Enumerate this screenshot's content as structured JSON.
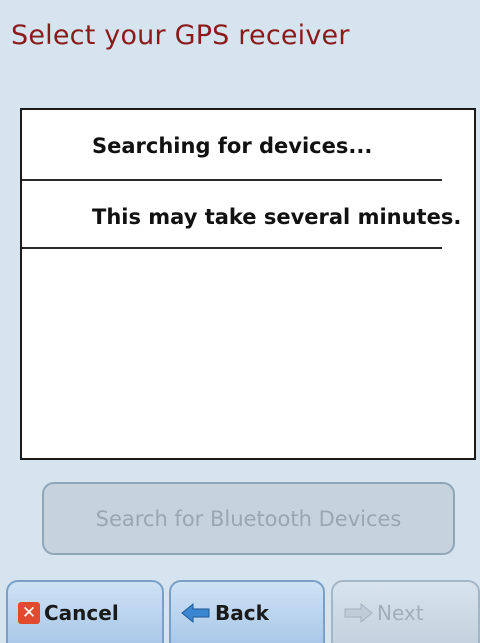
{
  "title": "Select your GPS receiver",
  "list": {
    "rows": [
      {
        "text": "Searching for devices..."
      },
      {
        "text": "This may take several minutes."
      }
    ]
  },
  "search_button": {
    "label": "Search for Bluetooth Devices",
    "enabled": false
  },
  "footer": {
    "cancel": {
      "label": "Cancel",
      "icon": "close-icon"
    },
    "back": {
      "label": "Back",
      "icon": "back-arrow-icon"
    },
    "next": {
      "label": "Next",
      "icon": "forward-arrow-icon",
      "enabled": false
    }
  },
  "colors": {
    "title": "#8b1a1a",
    "background": "#d6e4ef",
    "cancel_icon": "#e04a2f",
    "arrow_icon": "#3a86d0"
  }
}
